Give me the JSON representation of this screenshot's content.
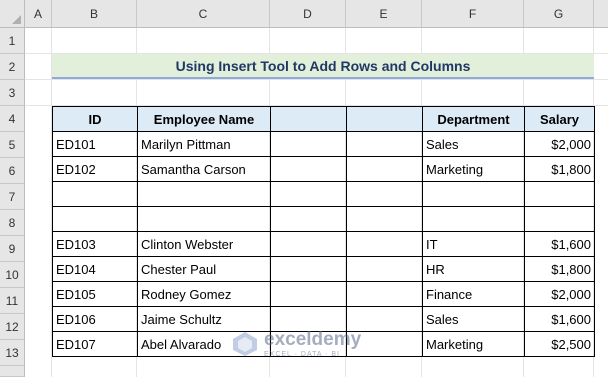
{
  "columns": [
    "A",
    "B",
    "C",
    "D",
    "E",
    "F",
    "G"
  ],
  "rows": [
    "1",
    "2",
    "3",
    "4",
    "5",
    "6",
    "7",
    "8",
    "9",
    "10",
    "11",
    "12",
    "13"
  ],
  "title": "Using Insert Tool to Add Rows and Columns",
  "table": {
    "headers": [
      "ID",
      "Employee Name",
      "",
      "",
      "Department",
      "Salary"
    ],
    "rows": [
      [
        "ED101",
        "Marilyn Pittman",
        "",
        "",
        "Sales",
        "$2,000"
      ],
      [
        "ED102",
        "Samantha Carson",
        "",
        "",
        "Marketing",
        "$1,800"
      ],
      [
        "",
        "",
        "",
        "",
        "",
        ""
      ],
      [
        "",
        "",
        "",
        "",
        "",
        ""
      ],
      [
        "ED103",
        "Clinton Webster",
        "",
        "",
        "IT",
        "$1,600"
      ],
      [
        "ED104",
        "Chester Paul",
        "",
        "",
        "HR",
        "$1,800"
      ],
      [
        "ED105",
        "Rodney Gomez",
        "",
        "",
        "Finance",
        "$2,000"
      ],
      [
        "ED106",
        "Jaime Schultz",
        "",
        "",
        "Sales",
        "$1,600"
      ],
      [
        "ED107",
        "Abel Alvarado",
        "",
        "",
        "Marketing",
        "$2,500"
      ]
    ]
  },
  "watermark": {
    "main": "exceldemy",
    "sub": "EXCEL · DATA · BI"
  }
}
